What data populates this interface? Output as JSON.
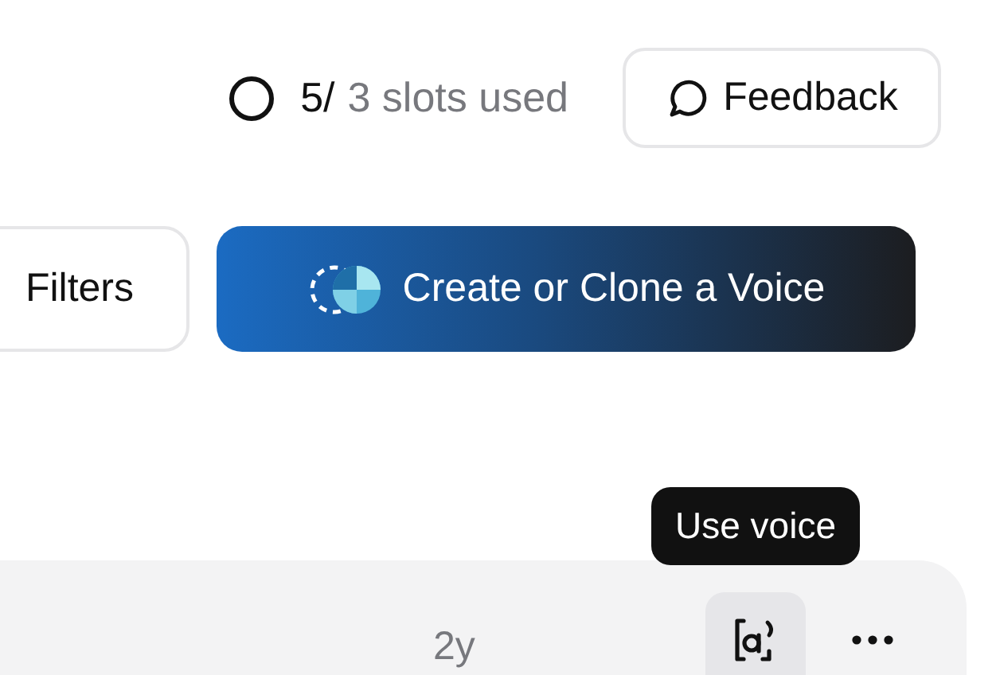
{
  "slots": {
    "used": "5/",
    "total": "3 slots used"
  },
  "feedback_button": {
    "label": "Feedback"
  },
  "filters_button": {
    "label": "Filters"
  },
  "create_button": {
    "label": "Create or Clone a Voice"
  },
  "tooltip": {
    "text": "Use voice"
  },
  "voice_row": {
    "age": "2y"
  }
}
